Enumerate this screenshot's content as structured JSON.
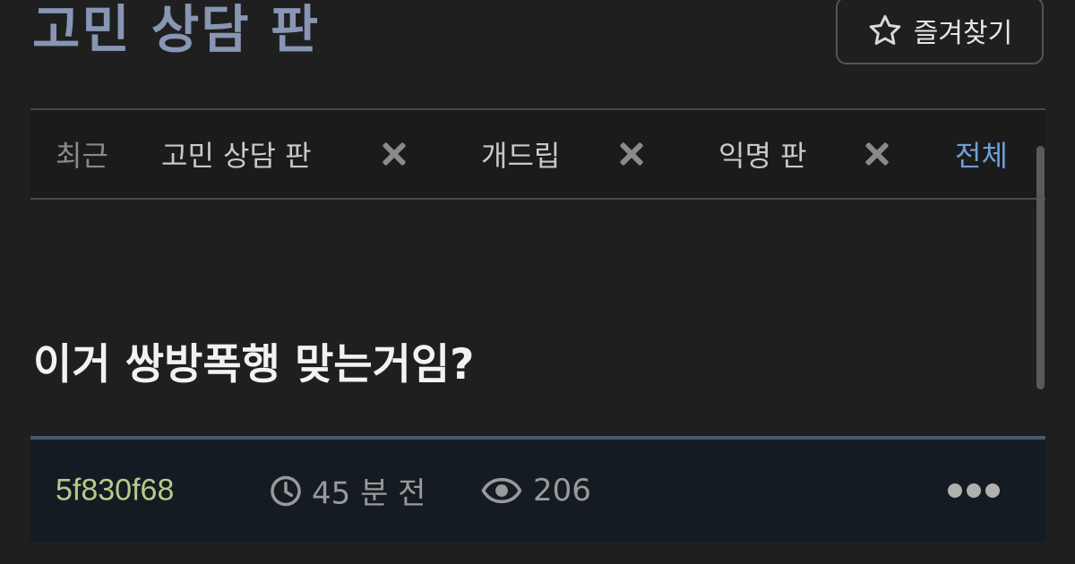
{
  "board": {
    "title": "고민 상담 판",
    "favorite_label": "즐겨찾기"
  },
  "recent": {
    "label": "최근",
    "tabs": [
      {
        "label": "고민 상담 판"
      },
      {
        "label": "개드립"
      },
      {
        "label": "익명 판"
      }
    ],
    "all_label": "전체"
  },
  "post": {
    "title": "이거 쌍방폭행 맞는거임?",
    "author": "5f830f68",
    "time": "45 분 전",
    "views": "206"
  },
  "icons": {
    "favorite": "star-outline-icon",
    "remove": "close-icon",
    "time": "clock-icon",
    "views": "eye-icon",
    "more": "more-horizontal-icon"
  },
  "colors": {
    "background": "#1f1f1f",
    "board_title": "#8796b3",
    "author": "#b7c98a",
    "link": "#6f9fd8",
    "meta_bar": "#151b22"
  }
}
